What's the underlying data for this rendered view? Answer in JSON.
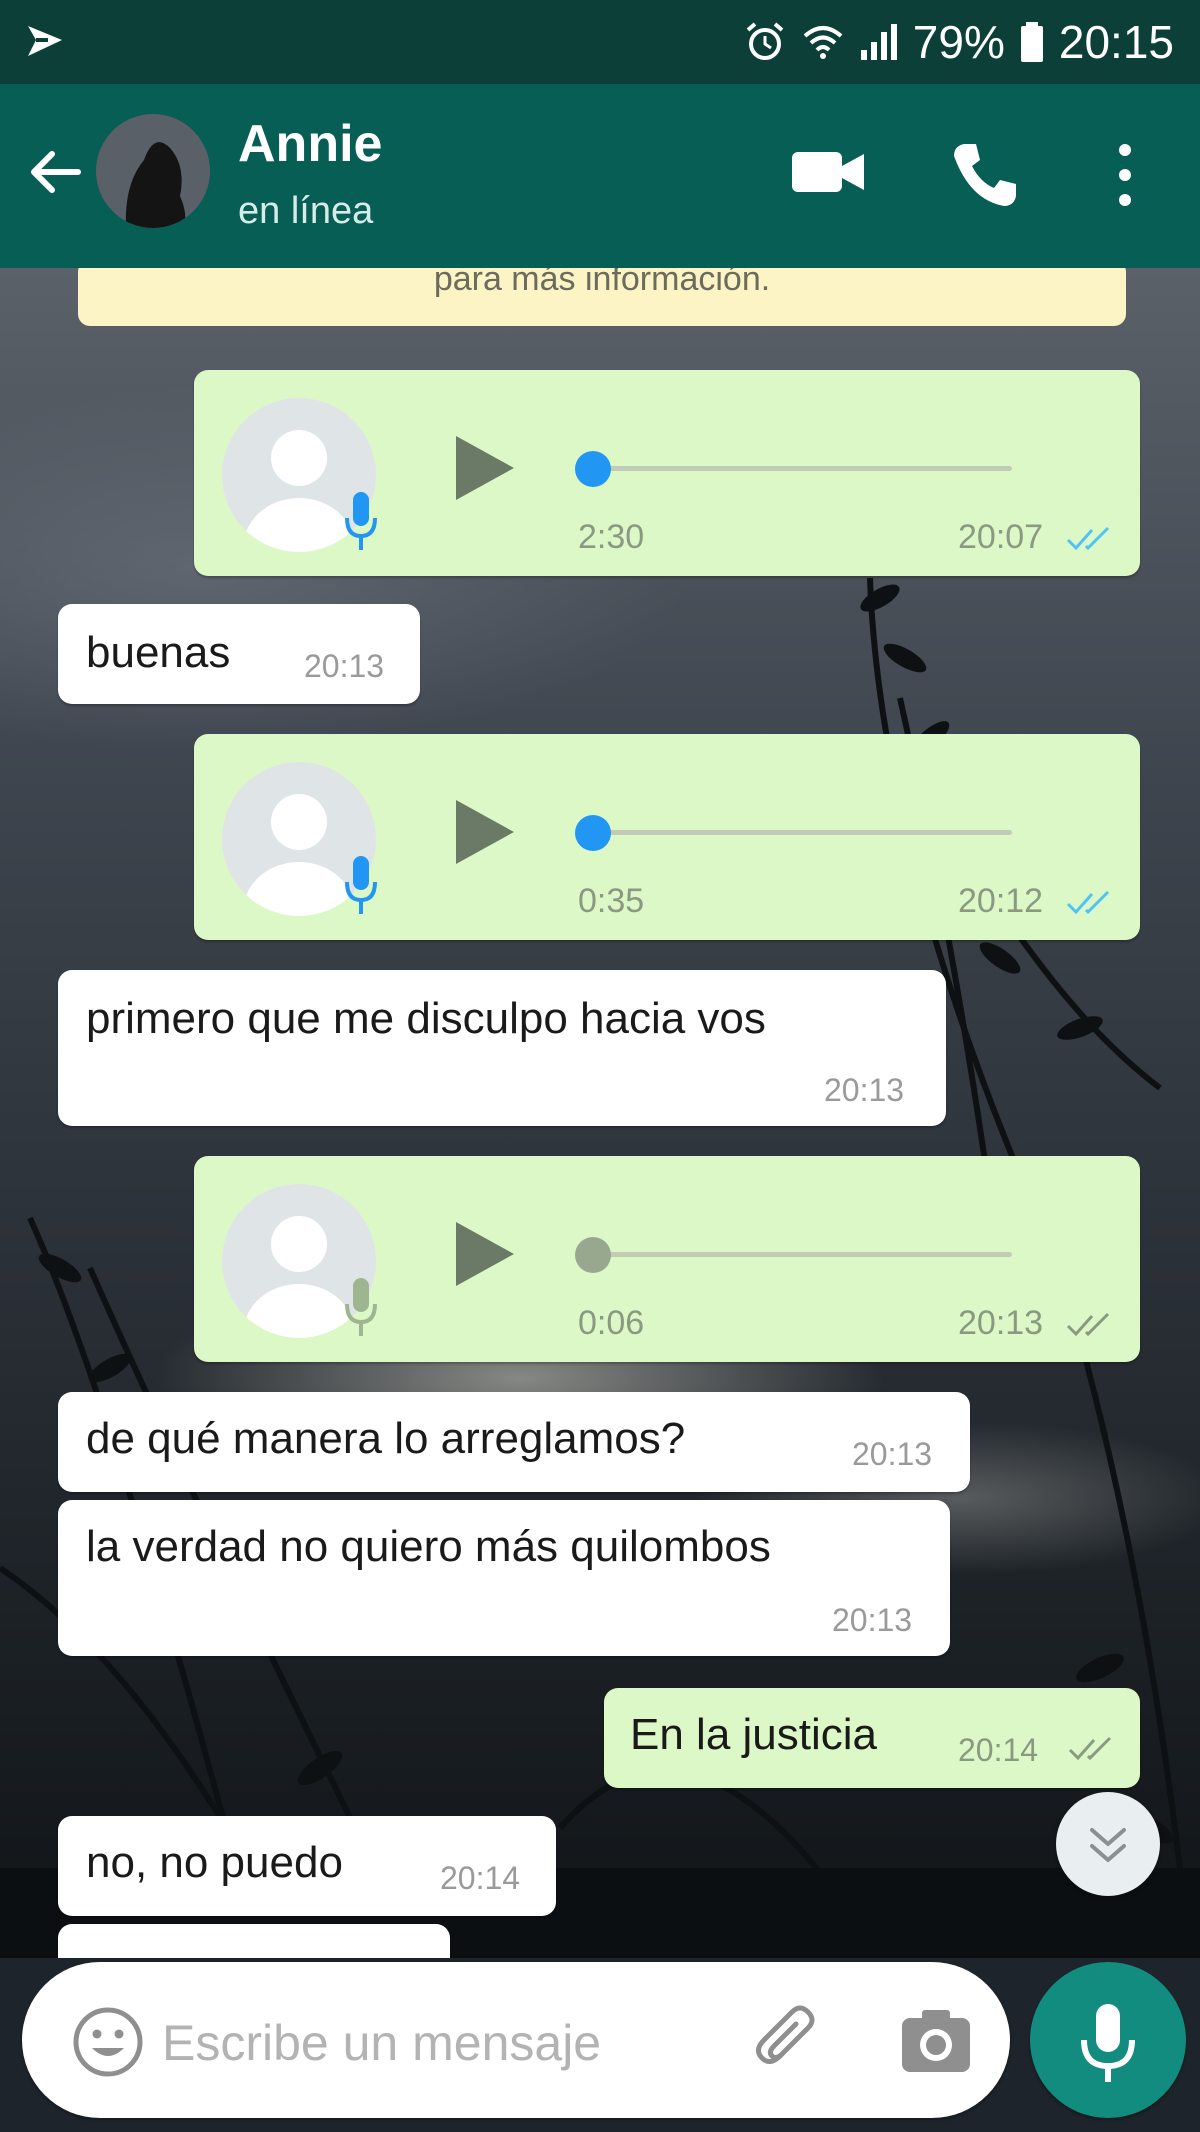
{
  "status_bar": {
    "app_icon": "app-notification-icon",
    "icons": [
      "alarm-icon",
      "wifi-icon",
      "signal-icon"
    ],
    "battery": "79%",
    "time": "20:15"
  },
  "header": {
    "back_icon": "arrow-back-icon",
    "contact_name": "Annie",
    "contact_status": "en línea",
    "actions": [
      "video-call-icon",
      "phone-icon",
      "more-vert-icon"
    ]
  },
  "chat": {
    "notice_text": "para más información.",
    "messages": [
      {
        "direction": "out",
        "type": "voice",
        "duration": "2:30",
        "time": "20:07",
        "status": "read",
        "played": false
      },
      {
        "direction": "in",
        "type": "text",
        "text": "buenas",
        "time": "20:13"
      },
      {
        "direction": "out",
        "type": "voice",
        "duration": "0:35",
        "time": "20:12",
        "status": "read",
        "played": false
      },
      {
        "direction": "in",
        "type": "text",
        "text": "primero que me disculpo hacia vos",
        "time": "20:13"
      },
      {
        "direction": "out",
        "type": "voice",
        "duration": "0:06",
        "time": "20:13",
        "status": "delivered",
        "played": true
      },
      {
        "direction": "in",
        "type": "text",
        "text": "de qué manera lo arreglamos?",
        "time": "20:13"
      },
      {
        "direction": "in",
        "type": "text",
        "text": "la verdad no quiero más quilombos",
        "time": "20:13"
      },
      {
        "direction": "out",
        "type": "text",
        "text": "En la justicia",
        "time": "20:14",
        "status": "delivered"
      },
      {
        "direction": "in",
        "type": "text",
        "text": "no, no puedo",
        "time": "20:14"
      }
    ]
  },
  "input_bar": {
    "placeholder": "Escribe un mensaje",
    "icons": [
      "emoji-icon",
      "attach-icon",
      "camera-icon",
      "microphone-icon"
    ]
  },
  "colors": {
    "header": "#075e54",
    "status_bar": "#0b3f37",
    "outgoing_bubble": "#dcf8c6",
    "incoming_bubble": "#ffffff",
    "read_ticks": "#4fc3f7",
    "unplayed_dot": "#2196f3",
    "mic_button": "#128c7e"
  }
}
